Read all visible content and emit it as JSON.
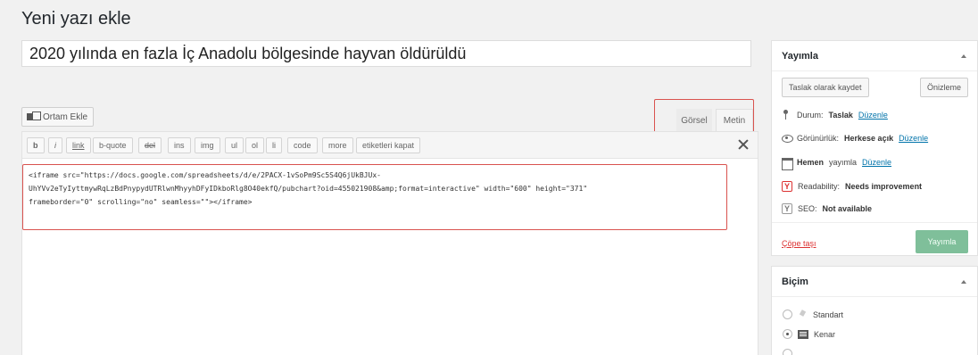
{
  "page": {
    "title": "Yeni yazı ekle"
  },
  "post": {
    "title": "2020 yılında en fazla İç Anadolu bölgesinde hayvan öldürüldü"
  },
  "editor": {
    "media_button": "Ortam Ekle",
    "tabs": {
      "visual": "Görsel",
      "text": "Metin"
    },
    "quicktags": {
      "b": "b",
      "i": "i",
      "link": "link",
      "bquote": "b-quote",
      "del": "del",
      "ins": "ins",
      "img": "img",
      "ul": "ul",
      "ol": "ol",
      "li": "li",
      "code": "code",
      "more": "more",
      "close": "etiketleri kapat"
    },
    "content_lines": [
      "<iframe src=\"https://docs.google.com/spreadsheets/d/e/2PACX-1vSoPm9Sc5S4Q6jUkBJUx-",
      "UhYVv2eTyIyttmywRqLzBdPnypydUTRlwnMhyyhDFyIDkboRlg8O40ekfQ/pubchart?oid=455021908&amp;format=interactive\" width=\"600\" height=\"371\"",
      "frameborder=\"0\" scrolling=\"no\" seamless=\"\"></iframe>"
    ]
  },
  "publish_box": {
    "title": "Yayımla",
    "save_draft": "Taslak olarak kaydet",
    "preview": "Önizleme",
    "status_label": "Durum:",
    "status_value": "Taslak",
    "visibility_label": "Görünürlük:",
    "visibility_value": "Herkese açık",
    "schedule_value": "Hemen",
    "schedule_label": "yayımla",
    "edit_link": "Düzenle",
    "readability_label": "Readability:",
    "readability_value": "Needs improvement",
    "seo_label": "SEO:",
    "seo_value": "Not available",
    "trash": "Çöpe taşı",
    "publish": "Yayımla"
  },
  "format_box": {
    "title": "Biçim",
    "options": [
      "Standart",
      "Kenar"
    ],
    "selected": "Kenar"
  },
  "colors": {
    "highlight": "#d9534f",
    "link": "#0073aa",
    "trash": "#dc3232",
    "publish_button": "#7fbf9a"
  }
}
